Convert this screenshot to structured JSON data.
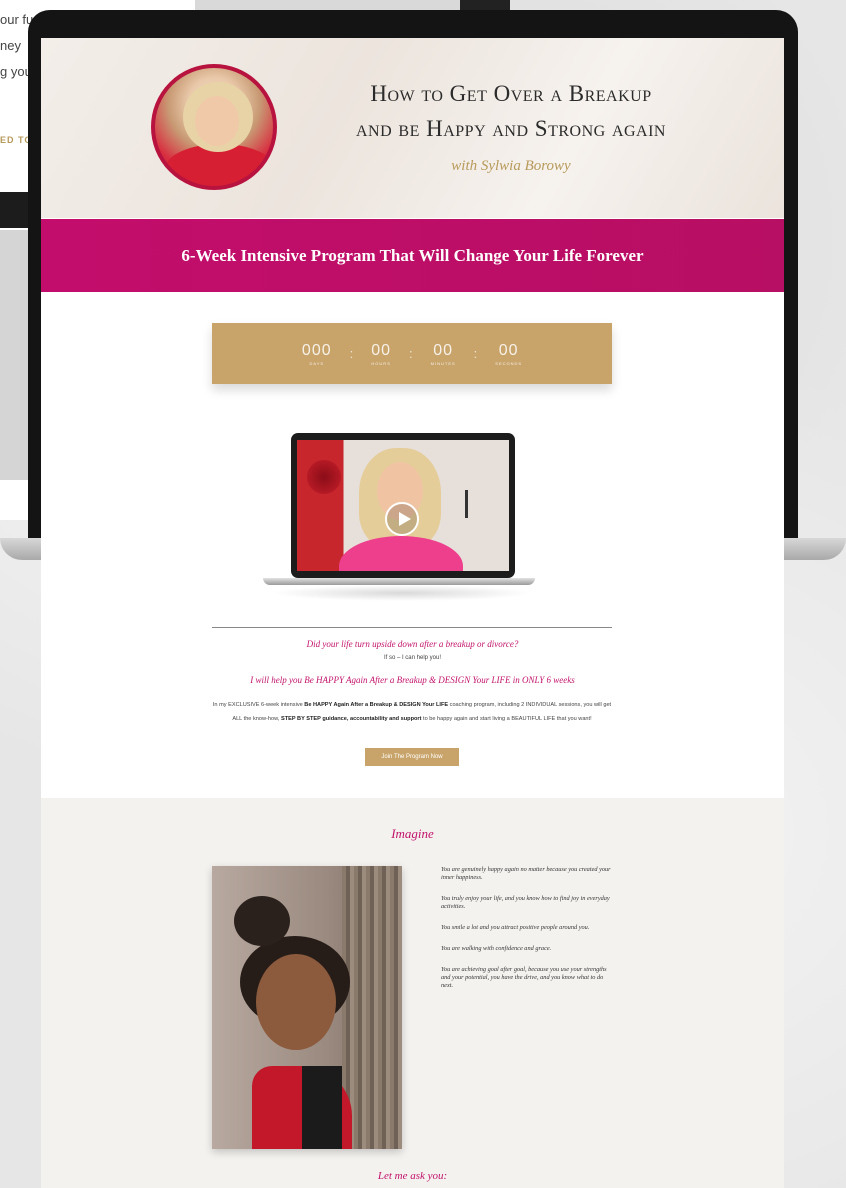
{
  "background_page": {
    "lines": [
      "our fu",
      "ney",
      "g you"
    ],
    "button_text": "ED TO"
  },
  "hero": {
    "title_line1": "How to Get Over a Breakup",
    "title_line2": "and be Happy and Strong again",
    "subtitle": "with Sylwia Borowy"
  },
  "banner": {
    "text": "6-Week Intensive Program That Will Change Your Life Forever"
  },
  "countdown": {
    "days": "000",
    "hours": "00",
    "minutes": "00",
    "seconds": "00",
    "days_label": "DAYS",
    "hours_label": "HOURS",
    "minutes_label": "MINUTES",
    "seconds_label": "SECONDS"
  },
  "intro": {
    "question": "Did your life turn upside down after a breakup or divorce?",
    "answer": "If so – I can help you!",
    "promise": "I will help you Be HAPPY Again After a Breakup & DESIGN Your LIFE in ONLY 6 weeks",
    "para_1": "In my EXCLUSIVE 6-week intensive ",
    "para_bold_1": "Be HAPPY Again After a Breakup & DESIGN Your LIFE",
    "para_2": " coaching program, including 2 INDIVIDUAL sessions, you will get ALL the know-how, ",
    "para_bold_2": "STEP BY STEP guidance, accountability and support",
    "para_3": " to be happy again and start living a BEAUTIFUL LIFE that you want!",
    "join_button": "Join The Program Now"
  },
  "imagine": {
    "title": "Imagine",
    "items": [
      "You are genuinely happy again no matter because you created your inner happiness.",
      "You truly enjoy your life, and you know how to find joy in everyday activities.",
      "You smile a lot and you attract positive people around you.",
      "You are walking with confidence and grace.",
      "You are achieving goal after goal, because you use your strengths and your potential, you have the drive, and you know what to do next."
    ]
  },
  "ask": {
    "title": "Let me ask you:"
  },
  "colors": {
    "magenta": "#c2136b",
    "gold": "#c8a46a",
    "banner": "#c30d6c"
  }
}
